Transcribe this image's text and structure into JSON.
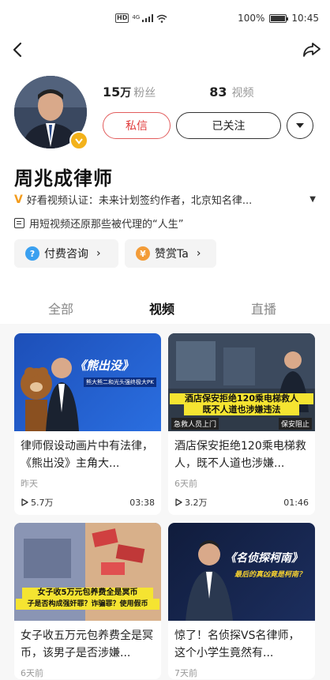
{
  "status_bar": {
    "network": "HD",
    "signal_label": "4G",
    "battery_percent": "100%",
    "time": "10:45"
  },
  "profile": {
    "followers_num": "15",
    "followers_unit": "万",
    "followers_label": "粉丝",
    "videos_num": "83",
    "videos_label": "视频",
    "message_label": "私信",
    "follow_label": "已关注",
    "name": "周兆成律师",
    "cert_text": "好看视频认证：未来计划签约作者，北京知名律...",
    "bio": "用短视频还原那些被代理的“人生”"
  },
  "pills": [
    {
      "label": "付费咨询",
      "icon": "question-icon",
      "color": "#3aa0f0"
    },
    {
      "label": "赞赏Ta",
      "icon": "coin-icon",
      "color": "#f39c38"
    }
  ],
  "tabs": [
    {
      "label": "全部",
      "active": false
    },
    {
      "label": "视频",
      "active": true
    },
    {
      "label": "直播",
      "active": false
    }
  ],
  "videos": [
    {
      "title": "律师假设动画片中有法律，《熊出没》主角大...",
      "date": "昨天",
      "plays": "5.7万",
      "duration": "03:38",
      "thumb_text": "《熊出没》",
      "thumb_sub": "熊大熊二和光头强终极大PK"
    },
    {
      "title": "酒店保安拒绝120乘电梯救人，既不人道也涉嫌...",
      "date": "6天前",
      "plays": "3.2万",
      "duration": "01:46",
      "thumb_text": "酒店保安拒绝120乘电梯救人",
      "thumb_sub": "既不人道也涉嫌违法",
      "thumb_tag1": "急救人员上门",
      "thumb_tag2": "保安阻止"
    },
    {
      "title": "女子收五万元包养费全是冥币，该男子是否涉嫌...",
      "date": "6天前",
      "thumb_text": "女子收5万元包养费全是冥币",
      "thumb_sub": "子是否构成强奸罪？诈骗罪？使用假币"
    },
    {
      "title": "惊了！名侦探VS名律师，这个小学生竟然有...",
      "date": "7天前",
      "thumb_text": "《名侦探柯南》",
      "thumb_sub": "最后的真凶竟是柯南？"
    }
  ]
}
